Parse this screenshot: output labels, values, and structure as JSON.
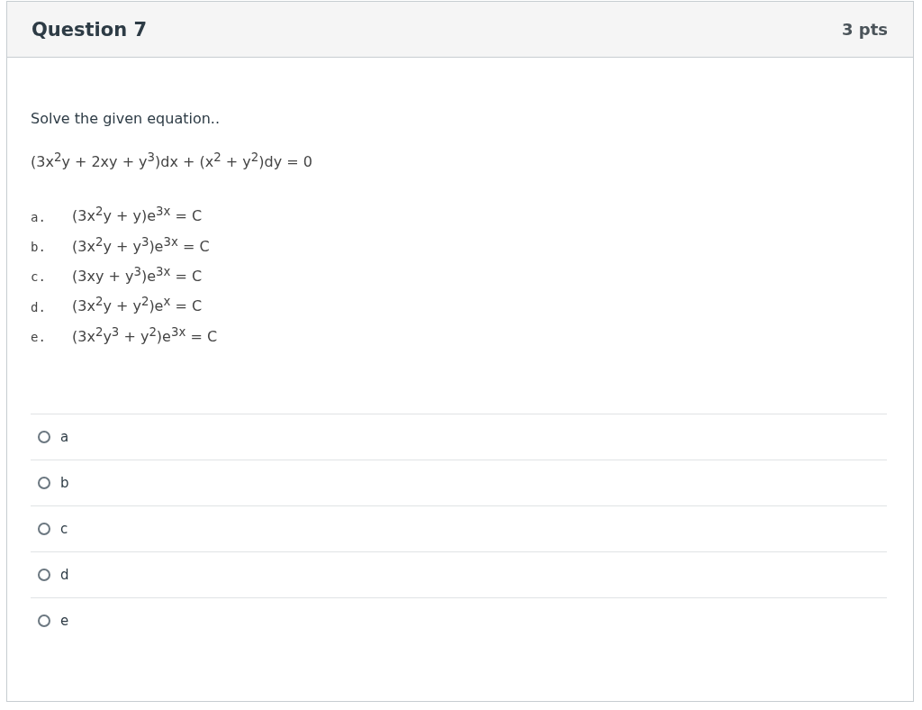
{
  "question": {
    "title": "Question 7",
    "points": "3 pts"
  },
  "prompt": "Solve the given equation..",
  "equation": "(3x$^{2}$y + 2xy + y$^{3}$)dx + (x$^{2}$ + y$^{2}$)dy = 0",
  "choices": [
    {
      "letter": "a.",
      "formula": "(3x$^{2}$y + y)e$^{3x}$ = C"
    },
    {
      "letter": "b.",
      "formula": "(3x$^{2}$y + y$^{3}$)e$^{3x}$ = C"
    },
    {
      "letter": "c.",
      "formula": "(3xy + y$^{3}$)e$^{3x}$ = C"
    },
    {
      "letter": "d.",
      "formula": "(3x$^{2}$y + y$^{2}$)e$^{x}$ = C"
    },
    {
      "letter": "e.",
      "formula": "(3x$^{2}$y$^{3}$ + y$^{2}$)e$^{3x}$ = C"
    }
  ],
  "answers": [
    {
      "label": "a",
      "selected": false
    },
    {
      "label": "b",
      "selected": false
    },
    {
      "label": "c",
      "selected": false
    },
    {
      "label": "d",
      "selected": false
    },
    {
      "label": "e",
      "selected": false
    }
  ]
}
